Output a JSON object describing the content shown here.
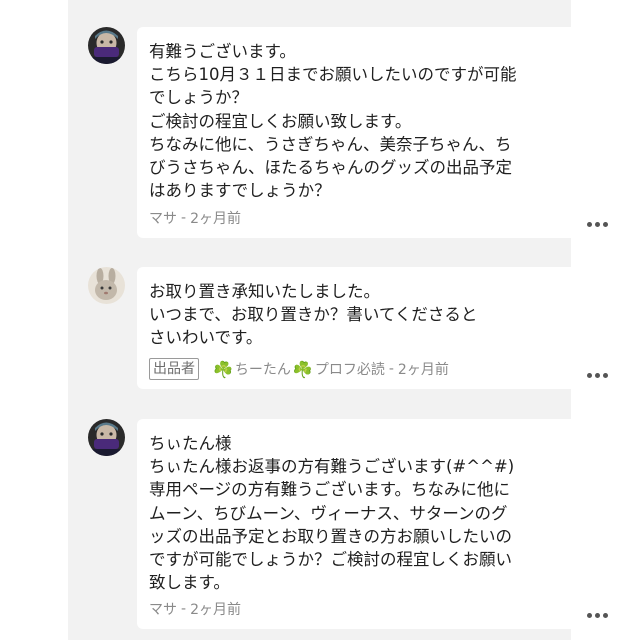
{
  "comments": [
    {
      "avatar": "masked-person-avatar",
      "lines": [
        "有難うございます。",
        "こちら10月３１日までお願いしたいのですが可能",
        "でしょうか？",
        "ご検討の程宜しくお願い致します。",
        "ちなみに他に、うさぎちゃん、美奈子ちゃん、ち",
        "びうさちゃん、ほたるちゃんのグッズの出品予定",
        "はありますでしょうか？"
      ],
      "author": "マサ",
      "time": "2ヶ月前"
    },
    {
      "avatar": "rabbit-avatar",
      "lines": [
        "お取り置き承知いたしました。",
        "いつまで、お取り置きか？書いてくださると",
        "さいわいです。"
      ],
      "badge": "出品者",
      "clover": "☘️",
      "author": "ちーたん",
      "author_suffix": "プロフ必読",
      "time": "2ヶ月前"
    },
    {
      "avatar": "masked-person-avatar",
      "lines": [
        "ちぃたん様",
        "ちぃたん様お返事の方有難うございます(#^^#)",
        "専用ページの方有難うございます。ちなみに他に",
        "ムーン、ちびムーン、ヴィーナス、サターンのグ",
        "ッズの出品予定とお取り置きの方お願いしたいの",
        "ですが可能でしょうか？ご検討の程宜しくお願い",
        "致します。"
      ],
      "author": "マサ",
      "time": "2ヶ月前"
    }
  ],
  "meta_separator": "-",
  "colors": {
    "feed_background": "#f2f2f2",
    "bubble_background": "#ffffff",
    "text": "#1f1f1f",
    "meta": "#8a8a8a",
    "clover": "#2eb34a"
  },
  "icons": {
    "more": "more-dots-icon",
    "clover": "clover-icon"
  }
}
